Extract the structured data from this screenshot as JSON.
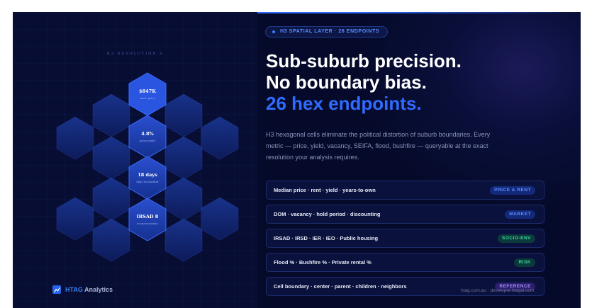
{
  "left_panel": {
    "resolution_label": "H3 RESOLUTION 8",
    "stats": [
      {
        "value": "$847K",
        "label": "med. price"
      },
      {
        "value": "4.8%",
        "label": "gross yield"
      },
      {
        "value": "18 days",
        "label": "days on market"
      },
      {
        "value": "IRSAD 8",
        "label": "socioeconomic"
      }
    ],
    "brand": {
      "name_accent": "HTAG",
      "name_rest": "Analytics",
      "icon": "chart-line-icon"
    }
  },
  "pill": {
    "text": "H3 SPATIAL LAYER · 26 ENDPOINTS"
  },
  "headline": {
    "line1": "Sub-suburb precision.",
    "line2": "No boundary bias.",
    "line3": "26 hex endpoints."
  },
  "description": "H3 hexagonal cells eliminate the political distortion of suburb boundaries. Every metric — price, yield, vacancy, SEIFA, flood, bushfire — queryable at the exact resolution your analysis requires.",
  "rows": [
    {
      "label": "Median price · rent · yield · years-to-own",
      "badge": "PRICE & RENT",
      "badge_color": "blue"
    },
    {
      "label": "DOM · vacancy · hold period · discounting",
      "badge": "MARKET",
      "badge_color": "blue"
    },
    {
      "label": "IRSAD · IRSD · IER · IEO · Public housing",
      "badge": "SOCIO-ENV",
      "badge_color": "green"
    },
    {
      "label": "Flood % · Bushfire % · Private rental %",
      "badge": "RISK",
      "badge_color": "green"
    },
    {
      "label": "Cell boundary · center · parent · children · neighbors",
      "badge": "REFERENCE",
      "badge_color": "purple"
    }
  ],
  "footnote": "htag.com.au · developer.htagai.com",
  "colors": {
    "accent_blue": "#2f6bff",
    "background": "#050a2a",
    "badge_green": "#38d39f",
    "badge_purple": "#a78bfa"
  }
}
